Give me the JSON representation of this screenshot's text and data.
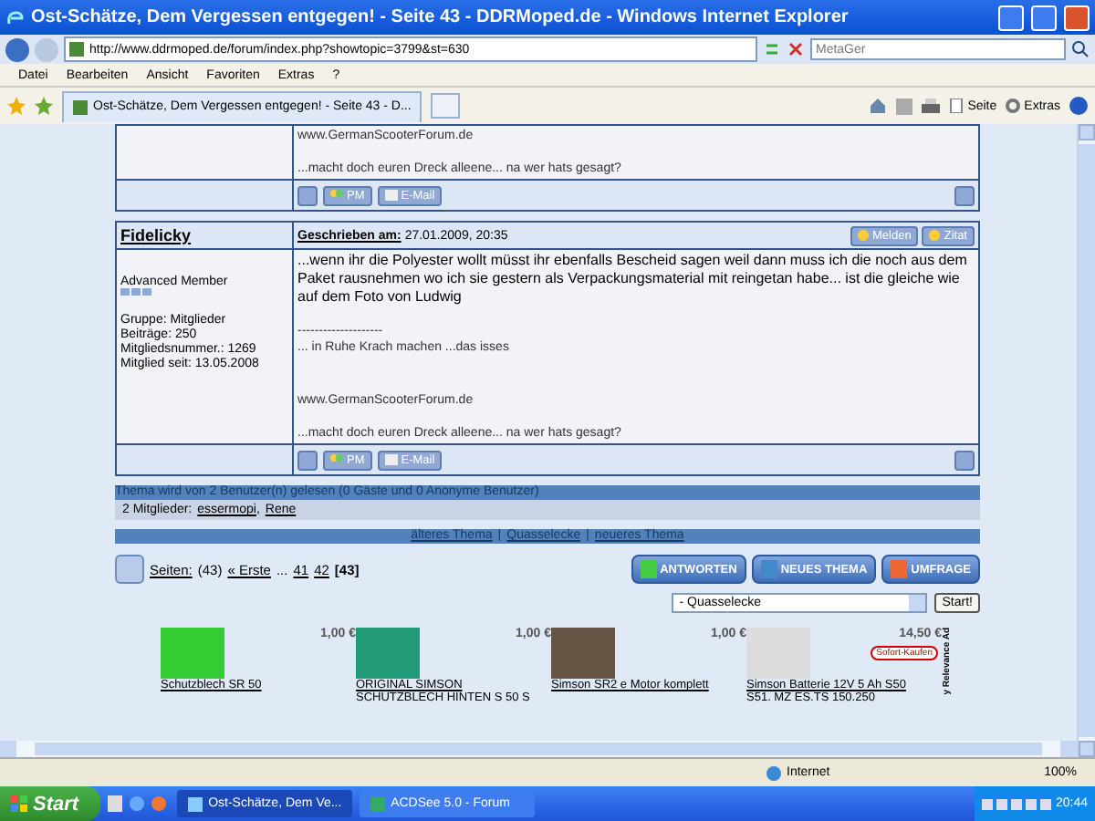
{
  "window": {
    "title": "Ost-Schätze, Dem Vergessen entgegen! - Seite 43 - DDRMoped.de - Windows Internet Explorer"
  },
  "address_bar": {
    "url": "http://www.ddrmoped.de/forum/index.php?showtopic=3799&st=630",
    "search_placeholder": "MetaGer"
  },
  "menu": [
    "Datei",
    "Bearbeiten",
    "Ansicht",
    "Favoriten",
    "Extras",
    "?"
  ],
  "tab": {
    "title": "Ost-Schätze, Dem Vergessen entgegen! - Seite 43 - D..."
  },
  "command_bar": [
    "Seite",
    "Extras"
  ],
  "posts": [
    {
      "signature": {
        "website": "www.GermanScooterForum.de",
        "tagline": "...macht doch euren Dreck alleene... na wer hats gesagt?"
      },
      "buttons": [
        "PM",
        "E-Mail"
      ]
    },
    {
      "author": "Fidelicky",
      "posted_label": "Geschrieben am:",
      "date": "27.01.2009, 20:35",
      "actions": [
        "Melden",
        "Zitat"
      ],
      "rank": "Advanced Member",
      "profile": [
        "Gruppe: Mitglieder",
        "Beiträge: 250",
        "Mitgliedsnummer.: 1269",
        "Mitglied seit: 13.05.2008"
      ],
      "body": "...wenn ihr die Polyester wollt müsst ihr ebenfalls Bescheid sagen weil dann muss ich die noch aus dem Paket rausnehmen wo ich sie gestern als Verpackungsmaterial mit reingetan habe... ist die gleiche wie auf dem Foto von Ludwig",
      "signature": {
        "divider": "--------------------",
        "motto": "... in Ruhe Krach machen ...das isses",
        "website": "www.GermanScooterForum.de",
        "tagline": "...macht doch euren Dreck alleene... na wer hats gesagt?"
      },
      "buttons": [
        "PM",
        "E-Mail"
      ]
    }
  ],
  "readers": {
    "title": "Thema wird von 2 Benutzer(n) gelesen (0 Gäste und 0 Anonyme Benutzer)",
    "members_label": "2 Mitglieder:",
    "members": [
      "essermopi",
      "Rene"
    ],
    "separator": ","
  },
  "topic_nav": {
    "links": [
      "älteres Thema",
      "Quasselecke",
      "neueres Thema"
    ],
    "separator": "|"
  },
  "pagination": {
    "label": "Seiten:",
    "count": "(43)",
    "first": "« Erste",
    "ellipsis": "...",
    "pages": [
      {
        "label": "41",
        "selected": false
      },
      {
        "label": "42",
        "selected": false
      },
      {
        "label": "[43]",
        "selected": true
      }
    ]
  },
  "action_buttons": [
    "ANTWORTEN",
    "NEUES THEMA",
    "UMFRAGE"
  ],
  "jump": {
    "value": "- Quasselecke",
    "button": "Start!"
  },
  "ads": [
    {
      "price": "1,00 €",
      "title": "Schutzblech SR 50"
    },
    {
      "price": "1,00 €",
      "title": "ORIGINAL SIMSON",
      "subtitle": "SCHUTZBLECH HINTEN S 50 S"
    },
    {
      "price": "1,00 €",
      "title": "Simson SR2 e Motor komplett"
    },
    {
      "price": "14,50 €",
      "badge": "Sofort-Kaufen",
      "title": "Simson Batterie 12V 5 Ah S50",
      "subtitle": "S51. MZ ES.TS 150.250"
    }
  ],
  "ad_label": "y Relevance Ad",
  "status_bar": {
    "zone": "Internet",
    "zoom": "100%"
  },
  "taskbar": {
    "start": "Start",
    "tasks": [
      {
        "label": "Ost-Schätze, Dem Ve...",
        "selected": true
      },
      {
        "label": "ACDSee 5.0 - Forum",
        "selected": false
      }
    ],
    "clock": "20:44"
  }
}
